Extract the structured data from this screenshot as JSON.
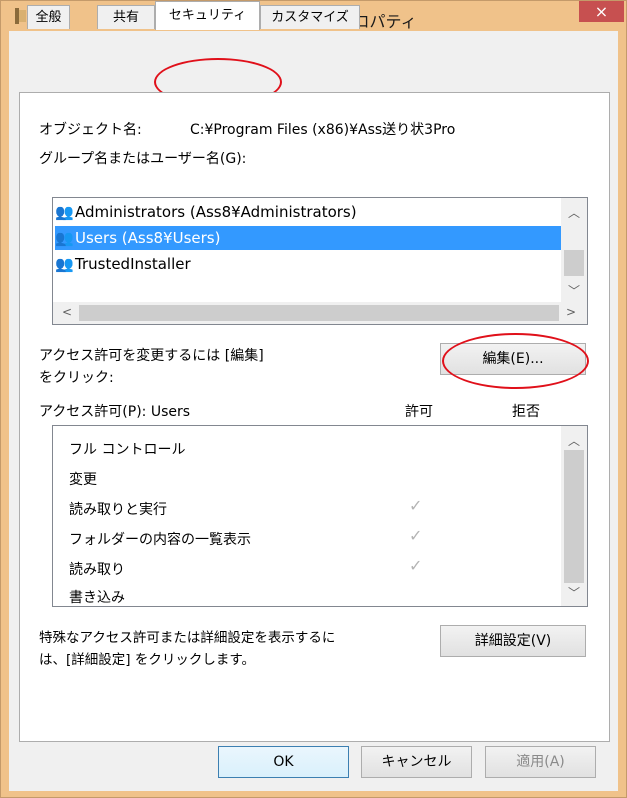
{
  "window": {
    "title": "Ass送り状3Proのプロパティ",
    "close_glyph": "×"
  },
  "tabs": [
    {
      "label": "全般"
    },
    {
      "label": "共有"
    },
    {
      "label": "セキュリティ"
    },
    {
      "label": "カスタマイズ"
    }
  ],
  "security": {
    "object_name_label": "オブジェクト名:",
    "object_name_value": "C:¥Program Files (x86)¥Ass送り状3Pro",
    "group_label": "グループ名またはユーザー名(G):",
    "principals": [
      {
        "name": "Administrators (Ass8¥Administrators)",
        "selected": false
      },
      {
        "name": "Users (Ass8¥Users)",
        "selected": true
      },
      {
        "name": "TrustedInstaller",
        "selected": false
      }
    ],
    "edit_hint_line1": "アクセス許可を変更するには [編集]",
    "edit_hint_line2": "をクリック:",
    "edit_button": "編集(E)...",
    "permissions_label": "アクセス許可(P): Users",
    "allow_header": "許可",
    "deny_header": "拒否",
    "permissions": [
      {
        "name": "フル コントロール",
        "allow": false
      },
      {
        "name": "変更",
        "allow": false
      },
      {
        "name": "読み取りと実行",
        "allow": true
      },
      {
        "name": "フォルダーの内容の一覧表示",
        "allow": true
      },
      {
        "name": "読み取り",
        "allow": true
      },
      {
        "name": "書き込み",
        "allow": false
      }
    ],
    "check_glyph": "✓",
    "advanced_hint_line1": "特殊なアクセス許可または詳細設定を表示するに",
    "advanced_hint_line2": "は、[詳細設定] をクリックします。",
    "advanced_button": "詳細設定(V)"
  },
  "footer": {
    "ok": "OK",
    "cancel": "キャンセル",
    "apply": "適用(A)"
  },
  "colors": {
    "title_bar": "#f0c28a",
    "selection": "#3399ff",
    "annotation": "#e0101a"
  }
}
